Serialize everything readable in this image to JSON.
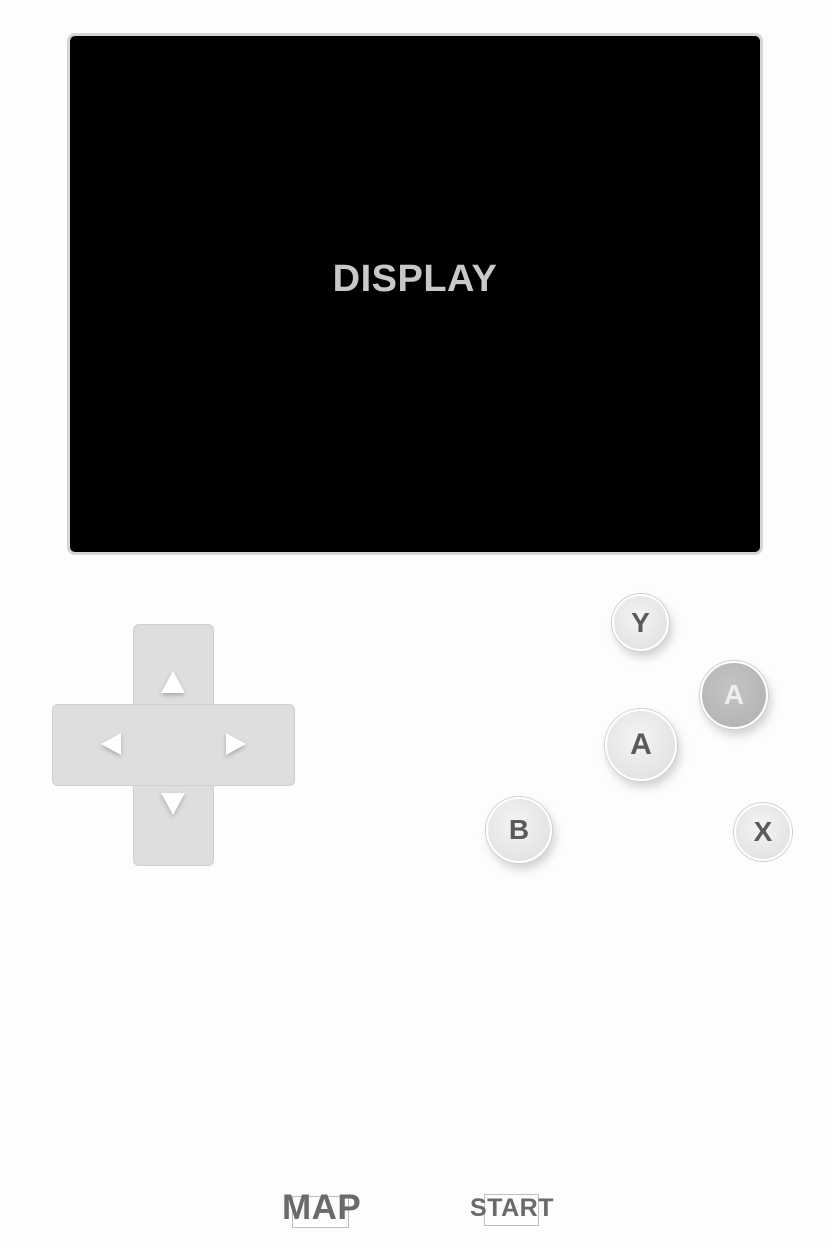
{
  "screen": {
    "label": "DISPLAY"
  },
  "buttons": {
    "y": "Y",
    "a_secondary": "A",
    "a": "A",
    "b": "B",
    "x": "X"
  },
  "bottom": {
    "map": "MAP",
    "start": "START"
  },
  "colors": {
    "background": "#fdfdfd",
    "screen": "#000000",
    "dpad": "#dedede",
    "button_text": "#5a5a5a"
  }
}
